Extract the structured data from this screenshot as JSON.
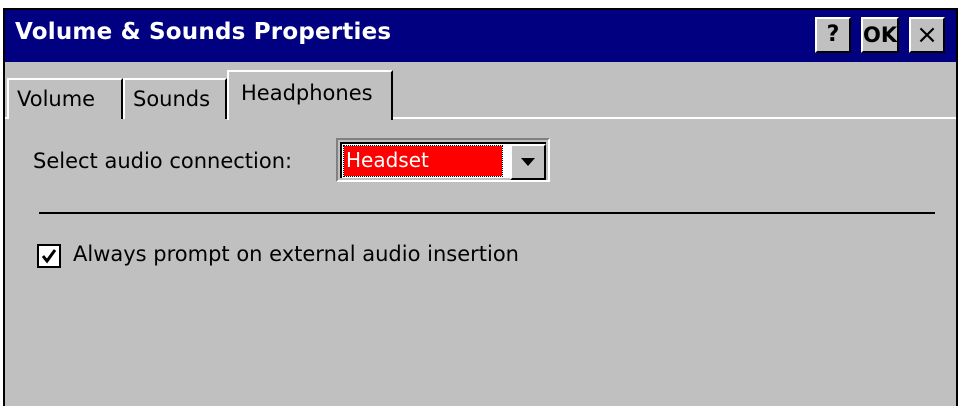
{
  "window": {
    "title": "Volume & Sounds Properties",
    "help_label": "?",
    "ok_label": "OK",
    "close_label": "×"
  },
  "tabs": [
    {
      "label": "Volume",
      "active": false
    },
    {
      "label": "Sounds",
      "active": false
    },
    {
      "label": "Headphones",
      "active": true
    }
  ],
  "headphones": {
    "connection_label": "Select audio connection:",
    "connection_value": "Headset",
    "prompt_checkbox_label": "Always prompt on external audio insertion",
    "prompt_checked": true
  },
  "icons": {
    "dropdown": "chevron-down-icon",
    "check": "check-icon"
  },
  "colors": {
    "titlebar": "#000080",
    "face": "#c0c0c0",
    "selection": "#ff0000"
  }
}
